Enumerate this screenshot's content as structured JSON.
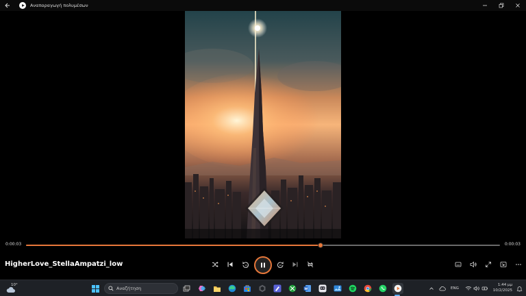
{
  "window": {
    "title": "Αναπαραγωγή πολυμέσων",
    "back_icon": "arrow-left-icon",
    "controls": [
      "minimize-icon",
      "maximize-icon",
      "close-icon"
    ]
  },
  "player": {
    "elapsed": "0:00:03",
    "remaining": "0:00:03",
    "progress": 0.621,
    "media_title": "HigherLove_StellaAmpatzi_low",
    "state": "playing",
    "accent": "#e8783a",
    "controls_left": [
      "shuffle-icon",
      "previous-icon",
      "rewind-10-icon"
    ],
    "controls_right": [
      "forward-30-icon",
      "next-icon",
      "repeat-off-icon"
    ],
    "controls_extra": [
      "subtitles-icon",
      "volume-icon",
      "fullscreen-icon",
      "mini-player-icon",
      "more-icon"
    ]
  },
  "taskbar": {
    "weather_temp": "10°",
    "search_placeholder": "Αναζήτηση",
    "language": "ENG",
    "time": "1:44 μμ",
    "date": "10/2/2025",
    "accent": "#60b0ff"
  }
}
